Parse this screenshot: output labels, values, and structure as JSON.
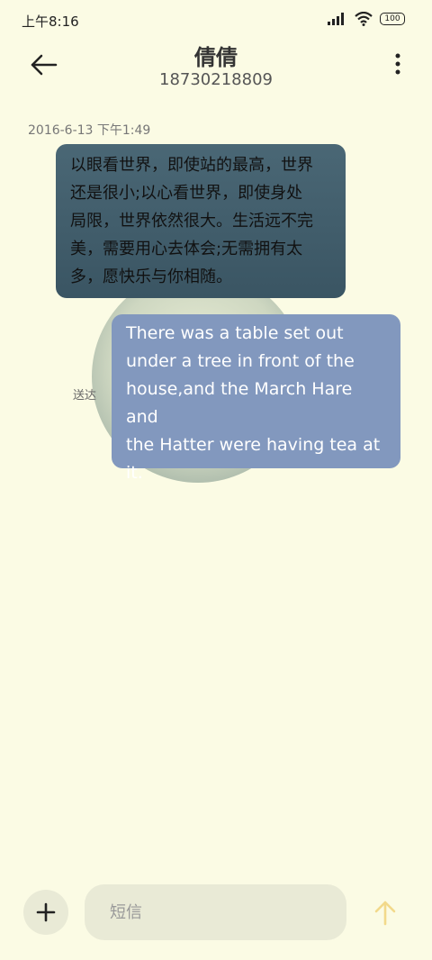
{
  "status_bar": {
    "time": "上午8:16",
    "battery": "100",
    "icons": [
      "signal-icon",
      "wifi-icon",
      "battery-icon"
    ]
  },
  "header": {
    "title": "倩倩",
    "phone": "18730218809",
    "back_icon": "arrow-left-icon",
    "more_icon": "more-vertical-icon"
  },
  "conversation": {
    "timestamp": "2016-6-13 下午1:49",
    "incoming": {
      "lines": [
        "以眼看世界，即使站的最高，世界",
        "还是很小;以心看世界，即使身处",
        "局限，世界依然很大。生活远不完",
        "美，需要用心去体会;无需拥有太",
        "多，愿快乐与你相随。"
      ]
    },
    "outgoing": {
      "lines": [
        "There was a table set out",
        "under a tree in front of the",
        "house,and the March Hare and",
        "the Hatter were having tea at",
        "it."
      ],
      "status": "送达"
    }
  },
  "composer": {
    "placeholder": "短信",
    "value": "",
    "add_icon": "plus-icon",
    "send_icon": "arrow-up-icon"
  },
  "colors": {
    "background": "#fbfbe4",
    "incoming_bubble": "#3f5b69",
    "outgoing_bubble": "#8298be",
    "send_accent": "#f2d98a"
  }
}
